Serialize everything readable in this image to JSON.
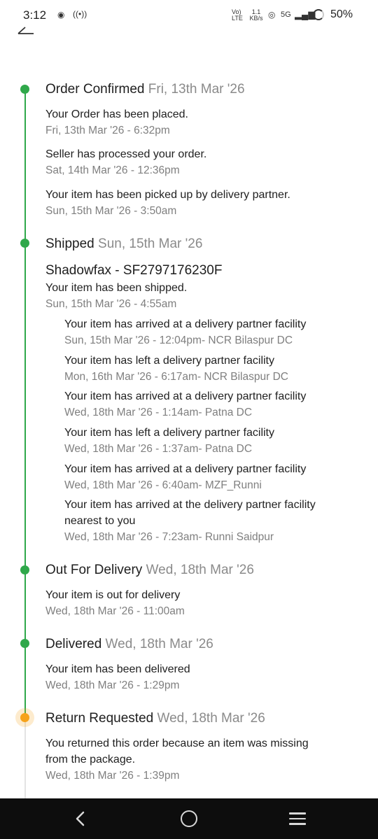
{
  "status_bar": {
    "time": "3:12",
    "left_icons": [
      "whatsapp-icon",
      "hotspot-icon"
    ],
    "network": "Vo) LTE",
    "speed": "1.1 KB/s",
    "signal": "5G",
    "battery": "50%"
  },
  "timeline": {
    "stages": [
      {
        "title": "Order Confirmed",
        "date": "Fri, 13th Mar '26",
        "events": [
          {
            "text": "Your Order has been placed.",
            "time": "Fri, 13th Mar '26 - 6:32pm"
          },
          {
            "text": "Seller has processed your order.",
            "time": "Sat, 14th Mar '26 - 12:36pm"
          },
          {
            "text": "Your item has been picked up by delivery partner.",
            "time": "Sun, 15th Mar '26 - 3:50am"
          }
        ]
      },
      {
        "title": "Shipped",
        "date": "Sun, 15th Mar '26",
        "courier": "Shadowfax - SF2797176230F",
        "events": [
          {
            "text": "Your item has been shipped.",
            "time": "Sun, 15th Mar '26 - 4:55am"
          }
        ],
        "sub_events": [
          {
            "text": "Your item has arrived at a delivery partner facility",
            "time": "Sun, 15th Mar '26 - 12:04pm- NCR Bilaspur DC"
          },
          {
            "text": "Your item has left a delivery partner facility",
            "time": "Mon, 16th Mar '26 - 6:17am- NCR Bilaspur DC"
          },
          {
            "text": "Your item has arrived at a delivery partner facility",
            "time": "Wed, 18th Mar '26 - 1:14am- Patna DC"
          },
          {
            "text": "Your item has left a delivery partner facility",
            "time": "Wed, 18th Mar '26 - 1:37am- Patna DC"
          },
          {
            "text": "Your item has arrived at a delivery partner facility",
            "time": "Wed, 18th Mar '26 - 6:40am- MZF_Runni"
          },
          {
            "text_line1": "Your item has arrived at the delivery partner facility",
            "text_line2": "nearest to you",
            "time": "Wed, 18th Mar '26 - 7:23am- Runni Saidpur"
          }
        ]
      },
      {
        "title": "Out For Delivery",
        "date": "Wed, 18th Mar '26",
        "events": [
          {
            "text": "Your item is out for delivery",
            "time": "Wed, 18th Mar '26 - 11:00am"
          }
        ]
      },
      {
        "title": "Delivered",
        "date": "Wed, 18th Mar '26",
        "events": [
          {
            "text": "Your item has been delivered",
            "time": "Wed, 18th Mar '26 - 1:29pm"
          }
        ]
      },
      {
        "title": "Return Requested",
        "date": "Wed, 18th Mar '26",
        "events": [
          {
            "text_line1": "You returned this order because an item was missing",
            "text_line2": "from the package.",
            "time": "Wed, 18th Mar '26 - 1:39pm"
          }
        ]
      }
    ]
  },
  "colors": {
    "completed": "#2fa84a",
    "current": "#f6a21a",
    "pending_track": "#e3e3e3"
  },
  "nav_icons": [
    "back-icon",
    "home-icon",
    "recents-icon"
  ]
}
